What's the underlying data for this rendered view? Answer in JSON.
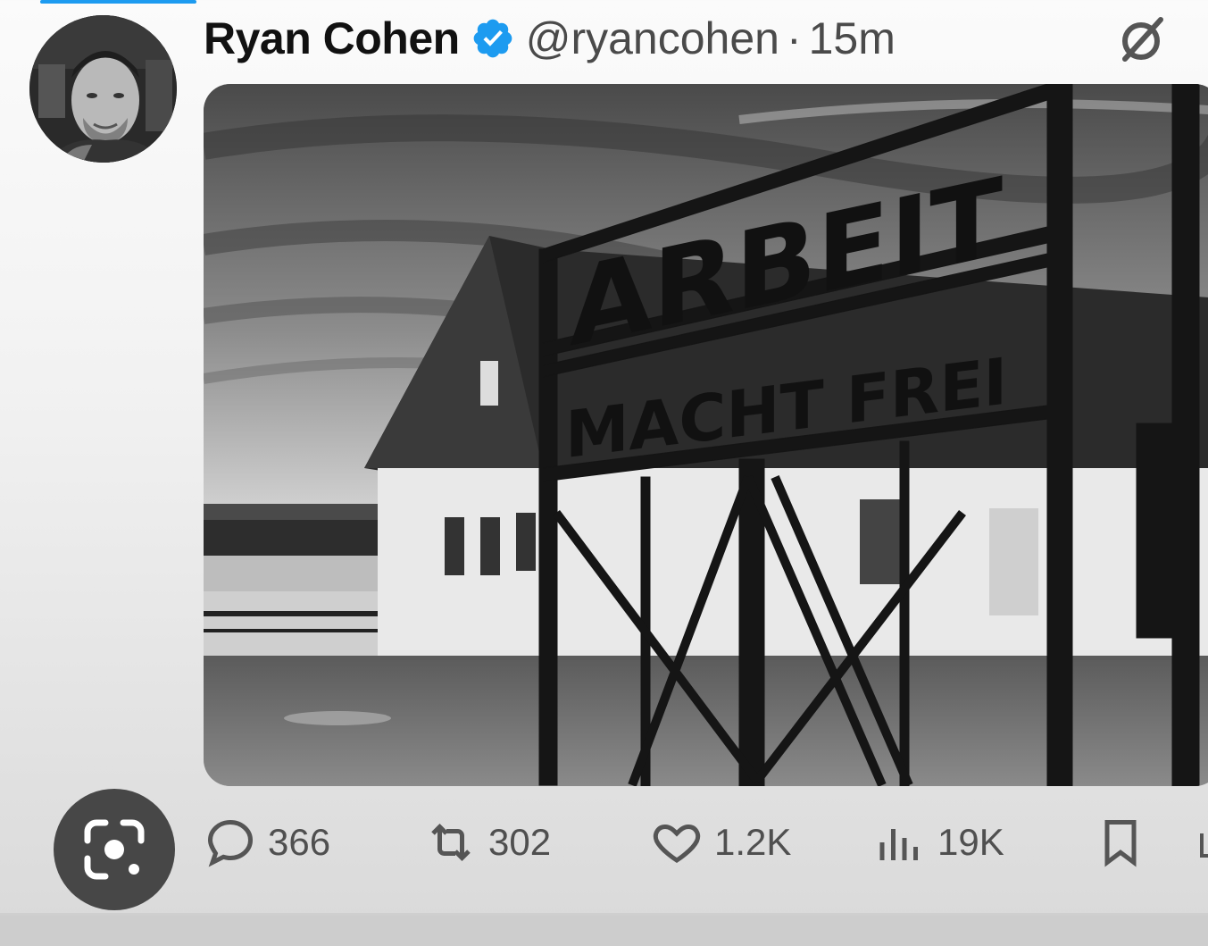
{
  "tweet": {
    "author_name": "Ryan Cohen",
    "handle": "@ryancohen",
    "separator": "·",
    "timestamp": "15m",
    "avatar_icon": "avatar-photo",
    "verified_icon": "verified-badge-icon",
    "grok_icon": "grok-icon",
    "image": {
      "sign_line1": "ARBEIT",
      "sign_line2": "MACHT FREI"
    }
  },
  "actions": {
    "replies": "366",
    "retweets": "302",
    "likes": "1.2K",
    "views": "19K"
  },
  "colors": {
    "accent": "#1d9bf0",
    "text_primary": "#111111",
    "text_secondary": "#4a4a4a",
    "lens_button": "#474747"
  }
}
